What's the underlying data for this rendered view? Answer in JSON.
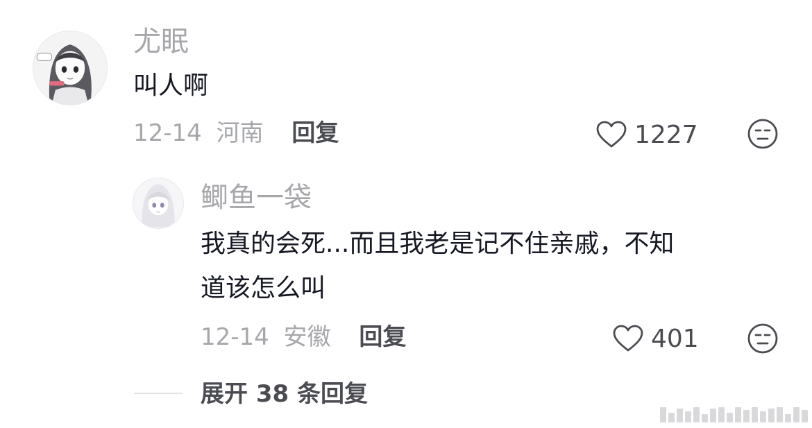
{
  "comment": {
    "username": "尤眠",
    "text": "叫人啊",
    "date": "12-14",
    "location": "河南",
    "reply_label": "回复",
    "likes": "1227",
    "avatar_icon": "anime-girl-avatar",
    "like_icon": "heart-outline-icon",
    "dislike_icon": "unamused-face-icon"
  },
  "reply": {
    "username": "鲫鱼一袋",
    "text_line1": "我真的会死...而且我老是记不住亲戚，不知",
    "text_line2": "道该怎么叫",
    "date": "12-14",
    "location": "安徽",
    "reply_label": "回复",
    "likes": "401",
    "avatar_icon": "anime-girl-avatar",
    "like_icon": "heart-outline-icon",
    "dislike_icon": "unamused-face-icon"
  },
  "expand_label": "展开 38 条回复",
  "colors": {
    "username": "#a6a7ab",
    "text": "#161823",
    "meta": "#a6a7ab",
    "action": "#4b4c52"
  }
}
